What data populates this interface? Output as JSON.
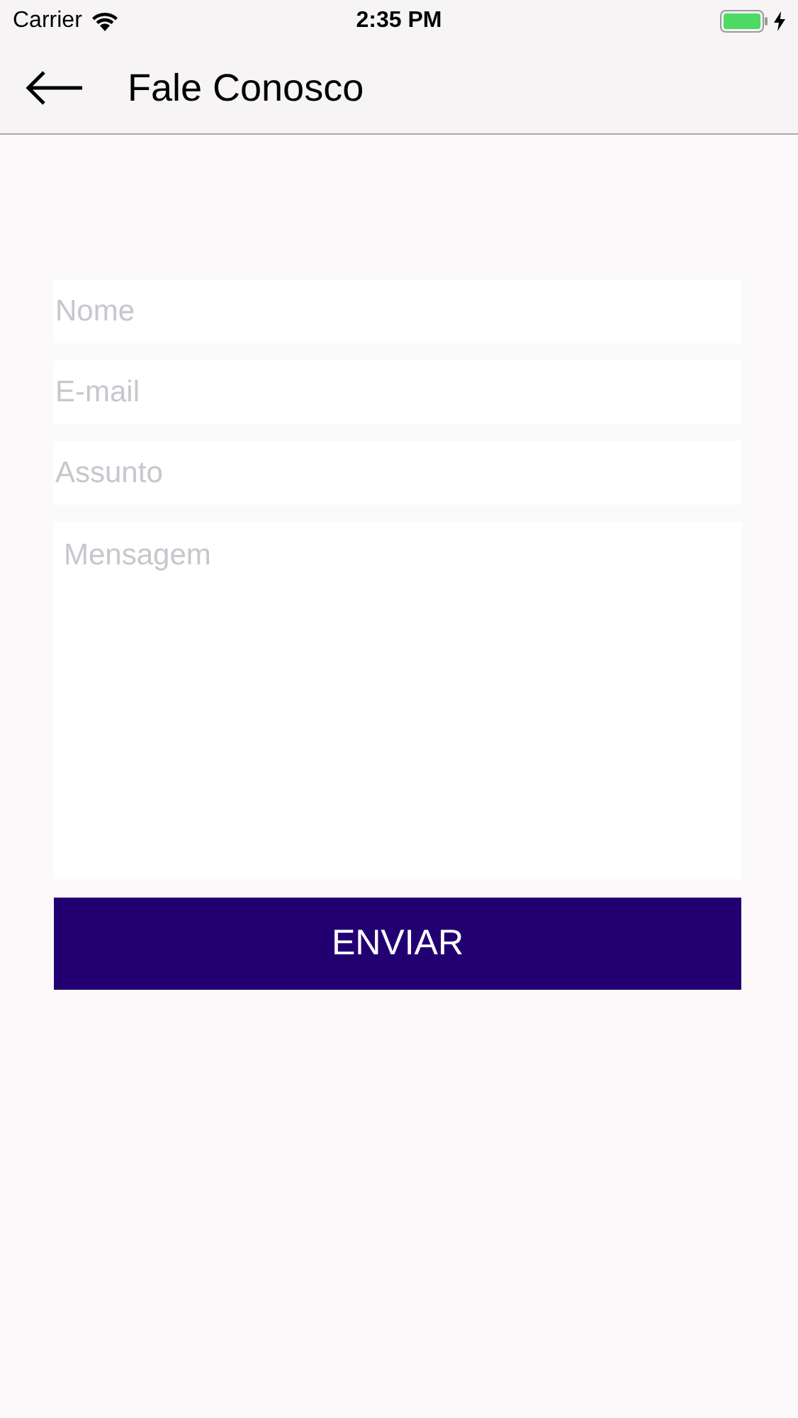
{
  "status_bar": {
    "carrier": "Carrier",
    "time": "2:35 PM"
  },
  "nav_bar": {
    "title": "Fale Conosco"
  },
  "form": {
    "fields": [
      {
        "kind": "input",
        "placeholder": "Nome"
      },
      {
        "kind": "input",
        "placeholder": "E-mail"
      },
      {
        "kind": "input",
        "placeholder": "Assunto"
      },
      {
        "kind": "textarea",
        "placeholder": "Mensagem"
      }
    ],
    "submit": "ENVIAR"
  }
}
